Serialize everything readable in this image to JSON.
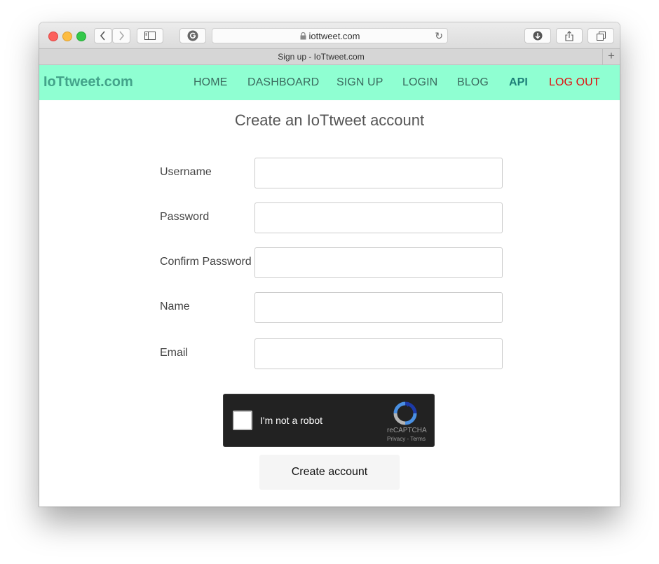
{
  "browser": {
    "url": "iottweet.com",
    "tab_title": "Sign up - IoTtweet.com",
    "new_tab_symbol": "+"
  },
  "nav": {
    "brand": "IoTtweet.com",
    "links": [
      "HOME",
      "DASHBOARD",
      "SIGN UP",
      "LOGIN",
      "BLOG",
      "API",
      "LOG OUT"
    ]
  },
  "form": {
    "title": "Create an IoTtweet account",
    "fields": [
      {
        "label": "Username",
        "value": ""
      },
      {
        "label": "Password",
        "value": ""
      },
      {
        "label": "Confirm Password",
        "value": ""
      },
      {
        "label": "Name",
        "value": ""
      },
      {
        "label": "Email",
        "value": ""
      }
    ],
    "captcha": {
      "label": "I'm not a robot",
      "brand": "reCAPTCHA",
      "terms": "Privacy - Terms",
      "checked": false
    },
    "submit_label": "Create account"
  },
  "colors": {
    "nav_bg": "#8fffd2",
    "brand": "#43a38a",
    "api_link": "#1d7f78",
    "logout_link": "#e01010"
  }
}
